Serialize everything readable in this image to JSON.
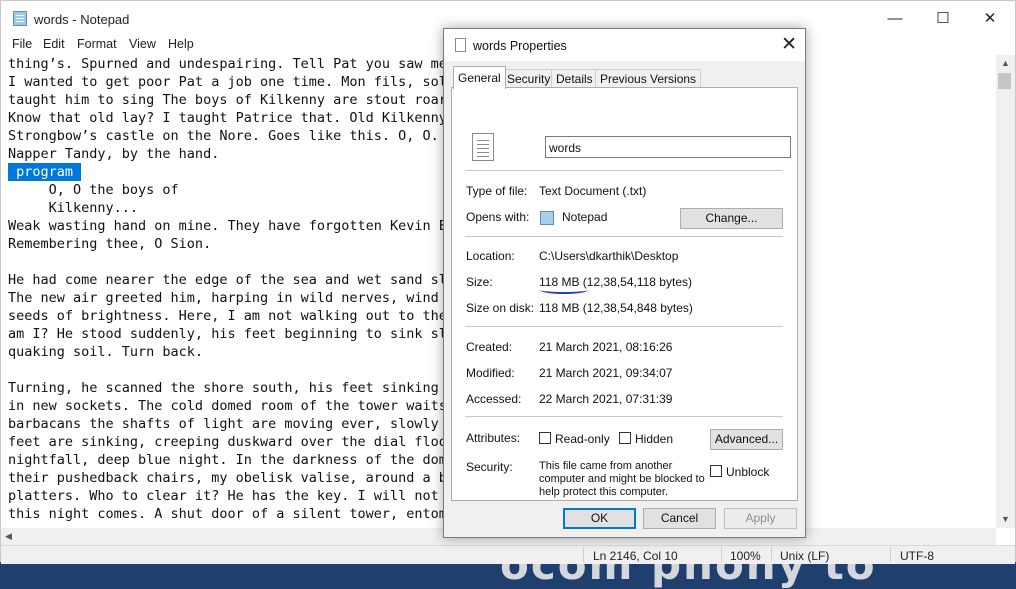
{
  "notepad": {
    "title": "words - Notepad",
    "window_controls": {
      "minimize": "—",
      "maximize": "☐",
      "close": "✕"
    },
    "menu": [
      "File",
      "Edit",
      "Format",
      "View",
      "Help"
    ],
    "lines": [
      "thing’s. Spurned and undespairing. Tell Pat you saw me,",
      "I wanted to get poor Pat a job one time. Mon fils, sold",
      "taught him to sing The boys of Kilkenny are stout roari",
      "Know that old lay? I taught Patrice that. Old Kilkenny:",
      "Strongbow’s castle on the Nore. Goes like this. O, O. H",
      "Napper Tandy, by the hand.",
      " program ",
      "     O, O the boys of",
      "     Kilkenny...",
      "Weak wasting hand on mine. They have forgotten Kevin Eg",
      "Remembering thee, O Sion.",
      "",
      "He had come nearer the edge of the sea and wet sand sla",
      "The new air greeted him, harping in wild nerves, wind o",
      "seeds of brightness. Here, I am not walking out to the ",
      "am I? He stood suddenly, his feet beginning to sink slo",
      "quaking soil. Turn back.",
      "",
      "Turning, he scanned the shore south, his feet sinking a",
      "in new sockets. The cold domed room of the tower waits.",
      "barbacans the shafts of light are moving ever, slowly e",
      "feet are sinking, creeping duskward over the dial floor",
      "nightfall, deep blue night. In the darkness of the dome",
      "their pushedback chairs, my obelisk valise, around a bo",
      "platters. Who to clear it? He has the key. I will not s",
      "this night comes. A shut door of a silent tower, entomb"
    ],
    "status": {
      "position": "Ln 2146, Col 10",
      "zoom": "100%",
      "line_ending": "Unix (LF)",
      "encoding": "UTF-8"
    }
  },
  "dialog": {
    "title": "words Properties",
    "close": "✕",
    "tabs": [
      "General",
      "Security",
      "Details",
      "Previous Versions"
    ],
    "file_name": "words",
    "type_label": "Type of file:",
    "type_value": "Text Document (.txt)",
    "opens_label": "Opens with:",
    "opens_value": "Notepad",
    "change_button": "Change...",
    "location_label": "Location:",
    "location_value": "C:\\Users\\dkarthik\\Desktop",
    "size_label": "Size:",
    "size_value": "118 MB (12,38,54,118 bytes)",
    "size_on_disk_label": "Size on disk:",
    "size_on_disk_value": "118 MB (12,38,54,848 bytes)",
    "created_label": "Created:",
    "created_value": "21 March 2021, 08:16:26",
    "modified_label": "Modified:",
    "modified_value": "21 March 2021, 09:34:07",
    "accessed_label": "Accessed:",
    "accessed_value": "22 March 2021, 07:31:39",
    "attributes_label": "Attributes:",
    "readonly_label": "Read-only",
    "hidden_label": "Hidden",
    "advanced_button": "Advanced...",
    "security_label": "Security:",
    "security_text_1": "This file came from another",
    "security_text_2": "computer and might be blocked to",
    "security_text_3": "help protect this computer.",
    "unblock_label": "Unblock",
    "ok_button": "OK",
    "cancel_button": "Cancel",
    "apply_button": "Apply"
  },
  "icons": {
    "notepad_icon": "notepad-icon",
    "document_icon": "document-icon"
  },
  "colors": {
    "selection": "#0078d7",
    "annotation_underline": "#2a3fbf"
  }
}
